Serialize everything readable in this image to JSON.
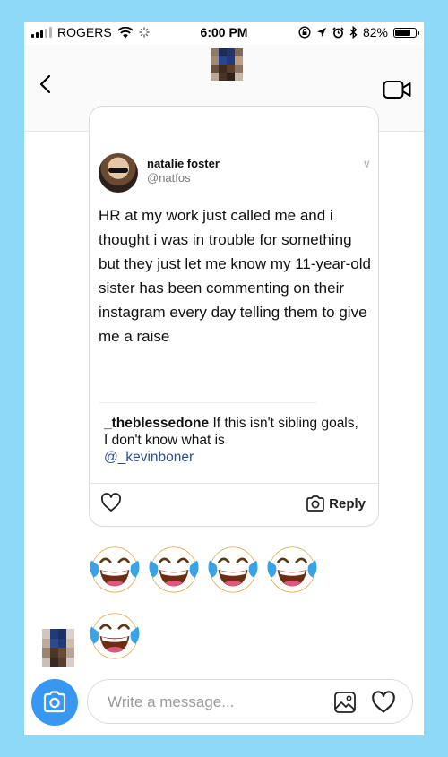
{
  "status_bar": {
    "carrier": "ROGERS",
    "time": "6:00 PM",
    "battery_percent": "82%",
    "battery_level": 0.82,
    "icons": [
      "signal-bars-icon",
      "wifi-icon",
      "loading-icon",
      "screen-lock-icon",
      "location-arrow-icon",
      "alarm-icon",
      "bluetooth-icon",
      "battery-icon"
    ]
  },
  "header": {
    "icons": [
      "back-chevron-icon",
      "video-call-icon",
      "chevron-right-icon"
    ],
    "name_pixelated": true
  },
  "shared_post": {
    "author_name": "natalie foster",
    "author_handle": "@natfos",
    "tweet_text": "HR at my work just called me and i thought i was in trouble for something but they just let me know my 11-year-old sister has been commenting on their instagram every day telling them to give me a raise",
    "comment_user": "_theblessedone",
    "comment_text": "If this isn't sibling goals, I don't know what is",
    "comment_mention": "@_kevinboner",
    "reply_label": "Reply",
    "icons": [
      "heart-icon",
      "camera-icon",
      "chevron-down-icon"
    ]
  },
  "reactions": {
    "row1": [
      "😂",
      "😂",
      "😂",
      "😂"
    ],
    "row2": [
      "😂"
    ]
  },
  "composer": {
    "placeholder": "Write a message...",
    "icons": [
      "camera-icon",
      "gallery-icon",
      "heart-icon"
    ]
  },
  "colors": {
    "page_bg": "#8fd9f8",
    "accent_blue": "#3897f0",
    "mention_blue": "#2d4e8c"
  }
}
